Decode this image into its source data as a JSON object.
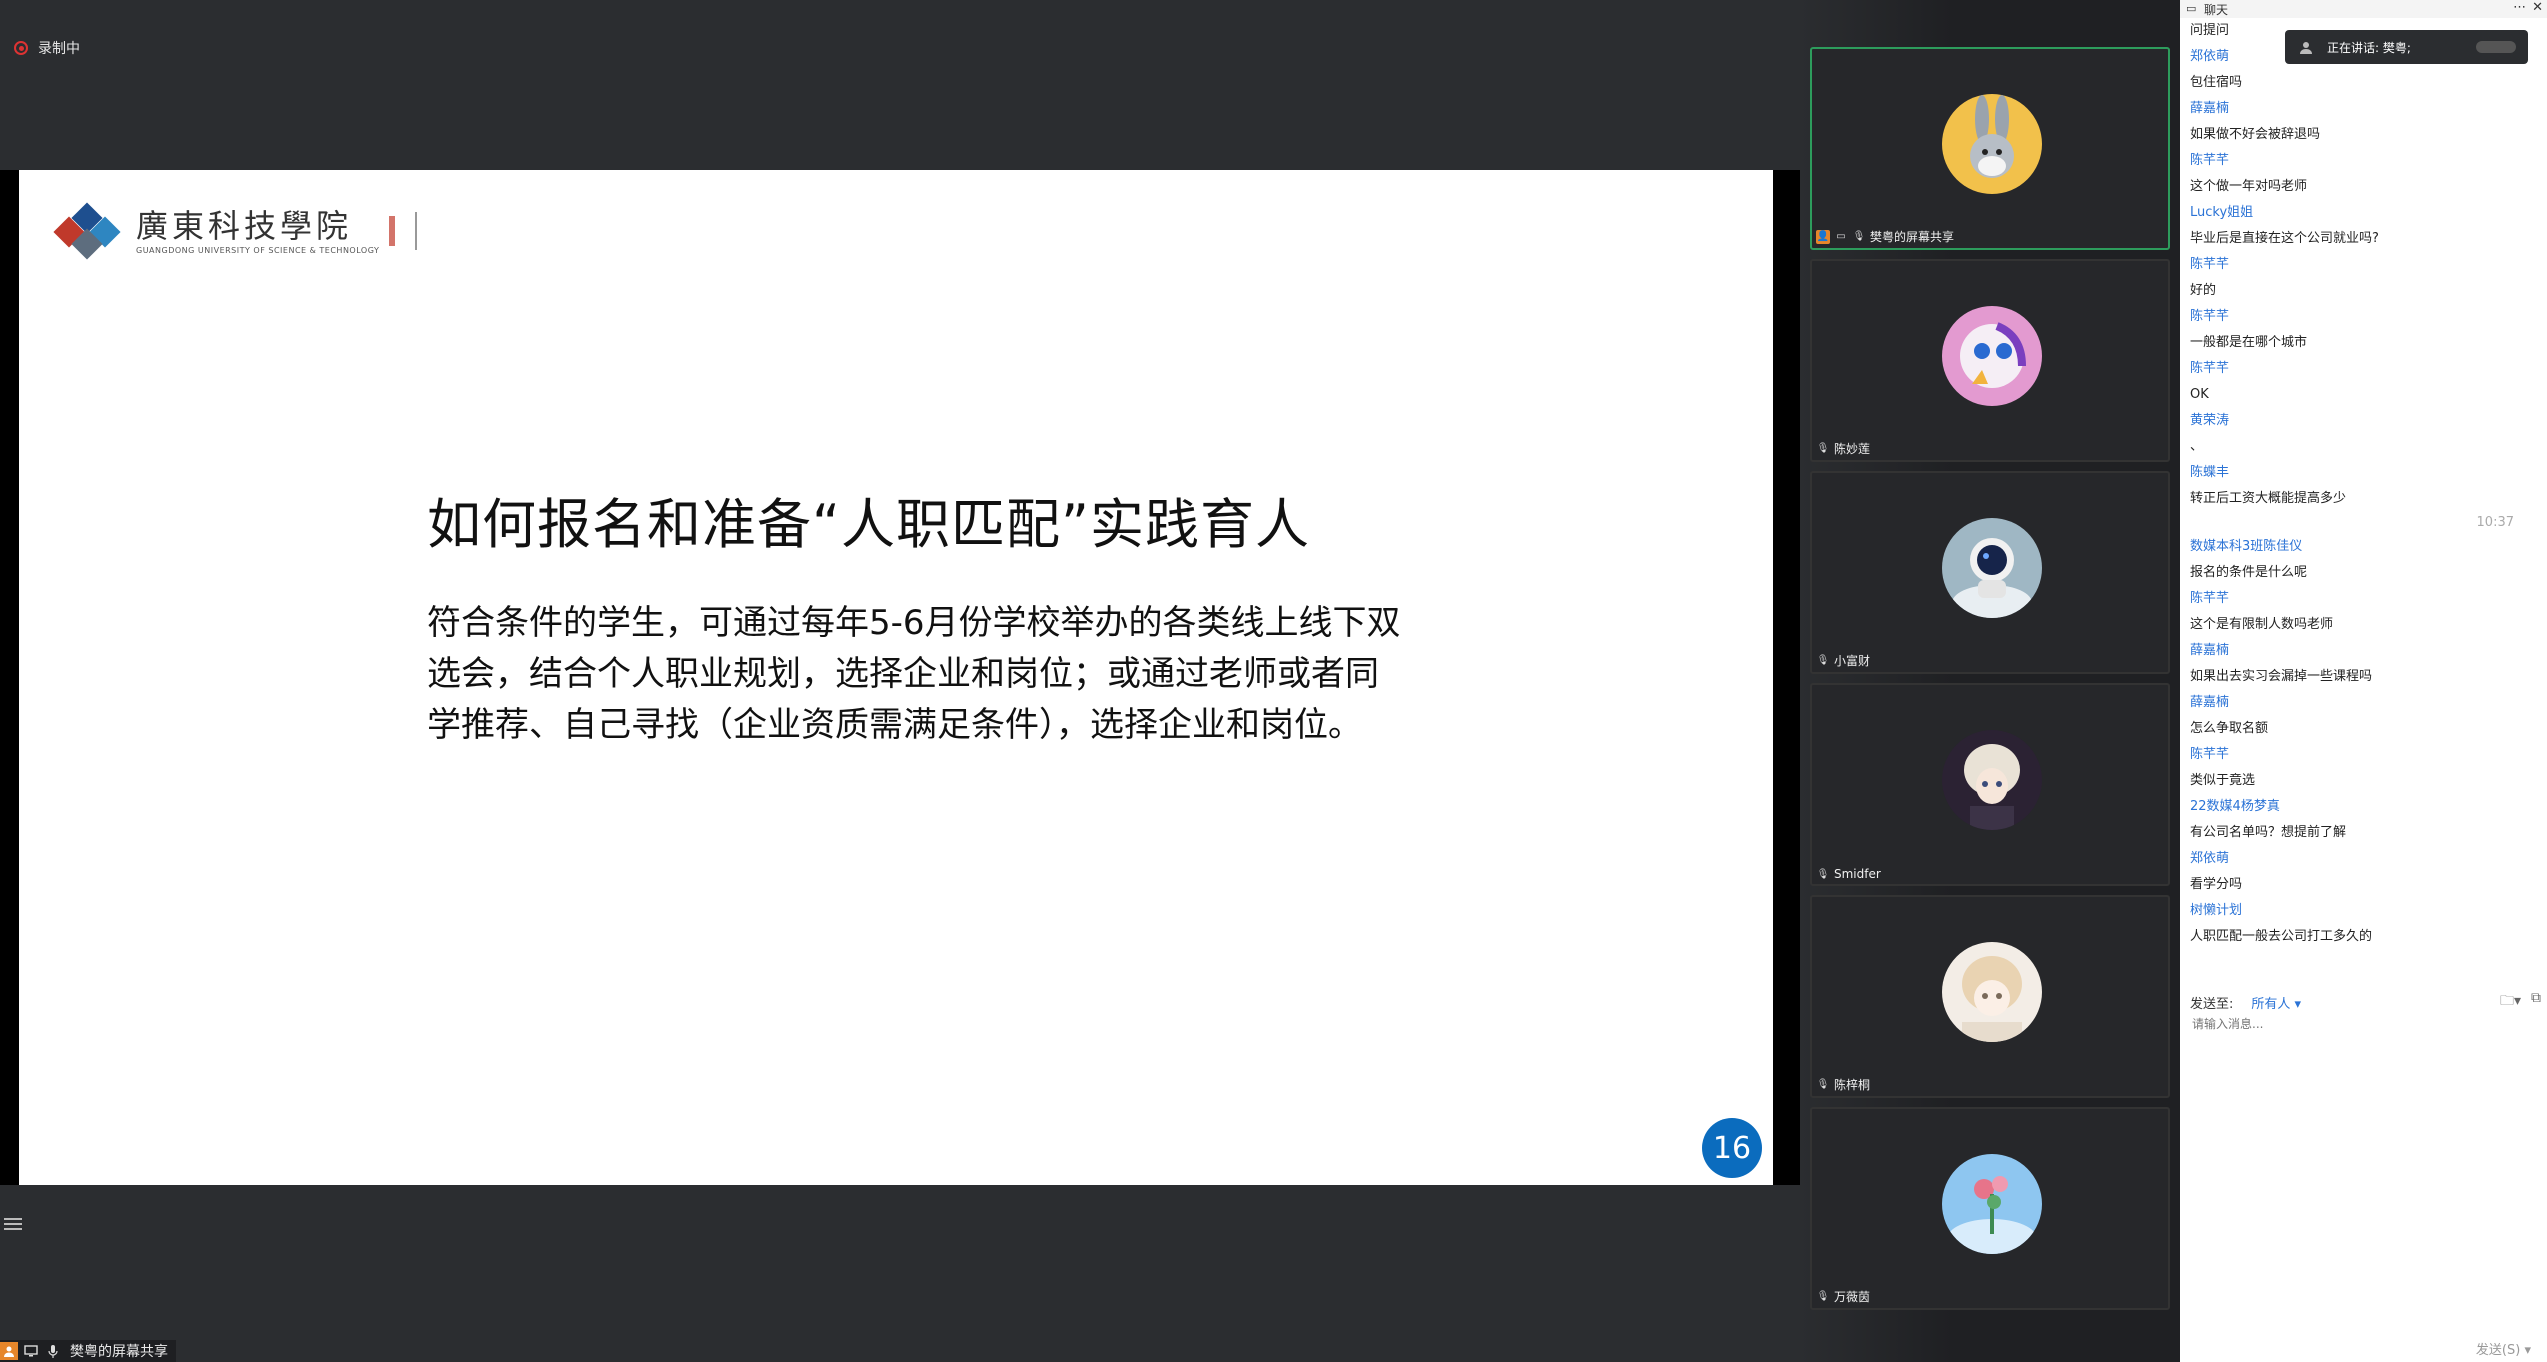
{
  "recording": {
    "label": "录制中"
  },
  "slide": {
    "logo_cn": "廣東科技學院",
    "logo_en": "GUANGDONG UNIVERSITY OF SCIENCE & TECHNOLOGY",
    "title": "如何报名和准备“人职匹配”实践育人",
    "body": "符合条件的学生，可通过每年5-6月份学校举办的各类线上线下双选会，结合个人职业规划，选择企业和岗位；或通过老师或者同学推荐、自己寻找（企业资质需满足条件），选择企业和岗位。",
    "page_number": "16"
  },
  "bottom_bar": {
    "label": "樊粤的屏幕共享"
  },
  "participants": [
    {
      "name": "樊粤的屏幕共享",
      "avatar": "bunny"
    },
    {
      "name": "陈妙莲",
      "avatar": "pink-cartoon"
    },
    {
      "name": "小富财",
      "avatar": "astronaut"
    },
    {
      "name": "Smidfer",
      "avatar": "anime-boy"
    },
    {
      "name": "陈梓桐",
      "avatar": "anime-girl"
    },
    {
      "name": "万薇茵",
      "avatar": "flowers"
    }
  ],
  "chat": {
    "title": "聊天",
    "speaking_now": "正在讲话: 樊粤;",
    "messages": [
      {
        "type": "text",
        "text": "问提问"
      },
      {
        "type": "name",
        "text": "郑依萌"
      },
      {
        "type": "text",
        "text": "包住宿吗"
      },
      {
        "type": "name",
        "text": "薛嘉楠"
      },
      {
        "type": "text",
        "text": "如果做不好会被辞退吗"
      },
      {
        "type": "name",
        "text": "陈芊芊"
      },
      {
        "type": "text",
        "text": "这个做一年对吗老师"
      },
      {
        "type": "name",
        "text": "Lucky姐姐"
      },
      {
        "type": "text",
        "text": "毕业后是直接在这个公司就业吗?"
      },
      {
        "type": "name",
        "text": "陈芊芊"
      },
      {
        "type": "text",
        "text": "好的"
      },
      {
        "type": "name",
        "text": "陈芊芊"
      },
      {
        "type": "text",
        "text": "一般都是在哪个城市"
      },
      {
        "type": "name",
        "text": "陈芊芊"
      },
      {
        "type": "text",
        "text": "OK"
      },
      {
        "type": "name",
        "text": "黄荣涛"
      },
      {
        "type": "text",
        "text": "、"
      },
      {
        "type": "name",
        "text": "陈蝶丰"
      },
      {
        "type": "text",
        "text": "转正后工资大概能提高多少"
      },
      {
        "type": "time",
        "text": "10:37"
      },
      {
        "type": "name",
        "text": "数媒本科3班陈佳仪"
      },
      {
        "type": "text",
        "text": "报名的条件是什么呢"
      },
      {
        "type": "name",
        "text": "陈芊芊"
      },
      {
        "type": "text",
        "text": "这个是有限制人数吗老师"
      },
      {
        "type": "name",
        "text": "薛嘉楠"
      },
      {
        "type": "text",
        "text": "如果出去实习会漏掉一些课程吗"
      },
      {
        "type": "name",
        "text": "薛嘉楠"
      },
      {
        "type": "text",
        "text": "怎么争取名额"
      },
      {
        "type": "name",
        "text": "陈芊芊"
      },
      {
        "type": "text",
        "text": "类似于竟选"
      },
      {
        "type": "name",
        "text": "22数媒4杨梦真"
      },
      {
        "type": "text",
        "text": "有公司名单吗？想提前了解"
      },
      {
        "type": "name",
        "text": "郑依萌"
      },
      {
        "type": "text",
        "text": "看学分吗"
      },
      {
        "type": "name",
        "text": "树懒计划"
      },
      {
        "type": "text",
        "text": "人职匹配一般去公司打工多久的"
      }
    ],
    "send_to_label": "发送至:",
    "send_to_target": "所有人",
    "input_placeholder": "请输入消息...",
    "send_button": "发送(S)"
  },
  "colors": {
    "accent": "#2b73d6",
    "slide_badge": "#0b6cbe",
    "active_tile": "#2d9c5c",
    "recording": "#dd3333"
  }
}
